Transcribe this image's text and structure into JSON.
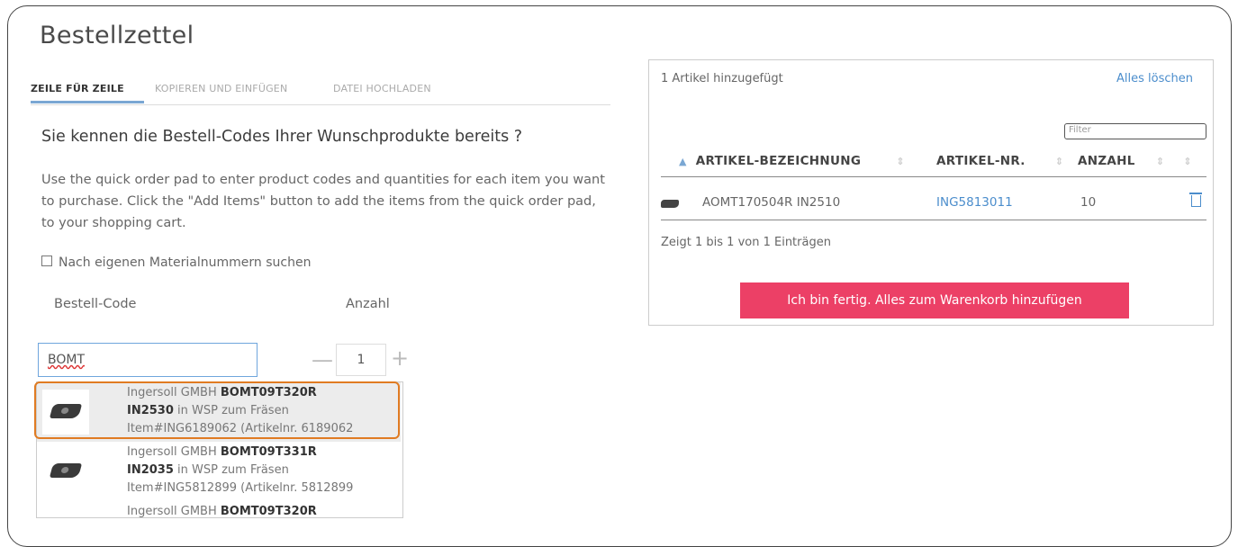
{
  "page": {
    "title": "Bestellzettel"
  },
  "tabs": [
    {
      "label": "ZEILE FÜR ZEILE",
      "active": true
    },
    {
      "label": "KOPIEREN UND EINFÜGEN",
      "active": false
    },
    {
      "label": "DATEI HOCHLADEN",
      "active": false
    }
  ],
  "form": {
    "heading": "Sie kennen die Bestell-Codes Ihrer Wunschprodukte bereits ?",
    "description": "Use the quick order pad to enter product codes and quantities for each item you want to purchase. Click the \"Add Items\" button to add the items from the quick order pad, to your shopping cart.",
    "own_numbers_label": "Nach eigenen Materialnummern suchen",
    "code_label": "Bestell-Code",
    "qty_label": "Anzahl",
    "code_value": "BOMT",
    "qty_value": "1",
    "minus": "—",
    "plus": "+"
  },
  "suggestions": [
    {
      "maker": "Ingersoll GMBH",
      "code1": "BOMT09T320R",
      "code2": "IN2530",
      "desc": "in WSP zum Fräsen",
      "item": "Item#ING6189062 (Artikelnr. 6189062",
      "highlighted": true
    },
    {
      "maker": "Ingersoll GMBH",
      "code1": "BOMT09T331R",
      "code2": "IN2035",
      "desc": "in WSP zum Fräsen",
      "item": "Item#ING5812899 (Artikelnr. 5812899",
      "highlighted": false
    },
    {
      "maker": "Ingersoll GMBH",
      "code1": "BOMT09T320R",
      "code2": "",
      "desc": "",
      "item": "",
      "highlighted": false
    }
  ],
  "cart": {
    "added_text": "1 Artikel hinzugefügt",
    "clear_all": "Alles löschen",
    "filter_placeholder": "Filter",
    "columns": {
      "name": "ARTIKEL-BEZEICHNUNG",
      "number": "ARTIKEL-NR.",
      "qty": "ANZAHL"
    },
    "sort_asc": "▲",
    "sort_both": "⇕",
    "rows": [
      {
        "name": "AOMT170504R IN2510",
        "number": "ING5813011",
        "qty": "10"
      }
    ],
    "info": "Zeigt 1 bis 1 von 1 Einträgen",
    "submit": "Ich bin fertig. Alles zum Warenkorb hinzufügen"
  },
  "colors": {
    "accent": "#4b8dcc",
    "cta": "#ec4066",
    "highlight_border": "#e07b22"
  }
}
